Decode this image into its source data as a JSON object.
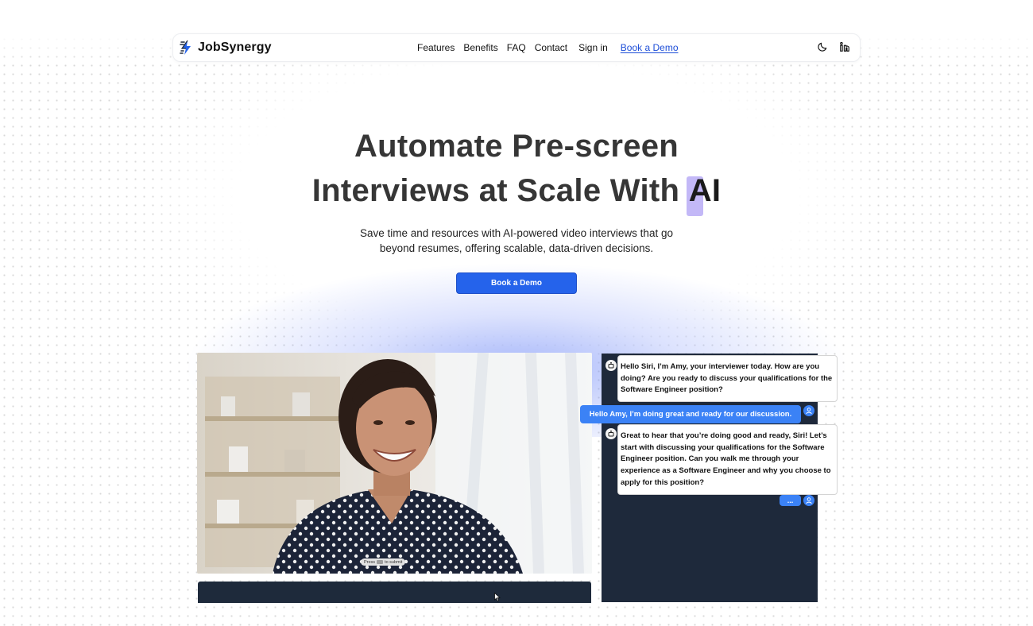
{
  "nav": {
    "brand": "JobSynergy",
    "links": [
      "Features",
      "Benefits",
      "FAQ",
      "Contact"
    ],
    "signin": "Sign in",
    "book_demo": "Book a Demo",
    "icons": [
      "moon-icon",
      "linkedin-icon"
    ]
  },
  "hero": {
    "title_line1": "Automate Pre-screen",
    "title_line2_prefix": "Interviews at Scale With",
    "title_ai": "AI",
    "subtitle_line1": "Save time and resources with AI-powered video interviews that go",
    "subtitle_line2": "beyond resumes, offering scalable, data-driven decisions.",
    "cta": "Book a Demo"
  },
  "video": {
    "press_hint_before": "Press",
    "press_hint_after": "to submit"
  },
  "chat": {
    "messages": [
      {
        "role": "interviewer",
        "text": "Hello Siri, I’m Amy, your interviewer today. How are you doing? Are you ready to discuss your qualifications for the Software Engineer position?"
      },
      {
        "role": "candidate",
        "text": "Hello Amy, I’m doing great and ready for our discussion."
      },
      {
        "role": "interviewer",
        "text": "Great to hear that you’re doing good and ready, Siri! Let’s start with discussing your qualifications for the Software Engineer position. Can you walk me through your experience as a Software Engineer and why you choose to apply for this position?"
      },
      {
        "role": "candidate",
        "text": "..."
      }
    ]
  },
  "colors": {
    "accent": "#2563eb",
    "chat_panel": "#1e293b",
    "user_bubble": "#3b82f6",
    "ai_highlight": "#c3b8f7"
  }
}
